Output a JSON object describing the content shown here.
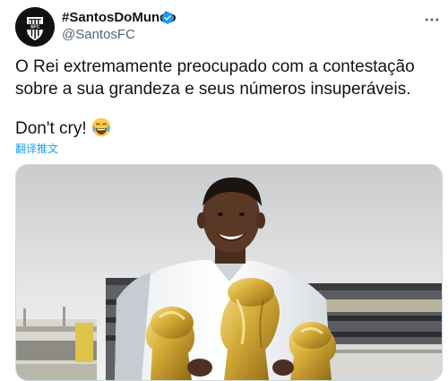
{
  "tweet": {
    "author": {
      "display_name": "#SantosDoMundo",
      "handle": "@SantosFC",
      "verified": true,
      "avatar_icon": "santos-crest-icon"
    },
    "text_line1": "O Rei extremamente preocupado com a contestação",
    "text_line2": "sobre a sua grandeza e seus números insuperáveis.",
    "text_line3": "Don't cry!",
    "emoji": "face-with-tears-of-joy",
    "translate_label": "翻译推文",
    "media": {
      "kind": "photo"
    }
  },
  "colors": {
    "accent": "#1d9bf0",
    "text": "#0f1419",
    "secondary": "#536471",
    "border": "#cfd9de"
  }
}
